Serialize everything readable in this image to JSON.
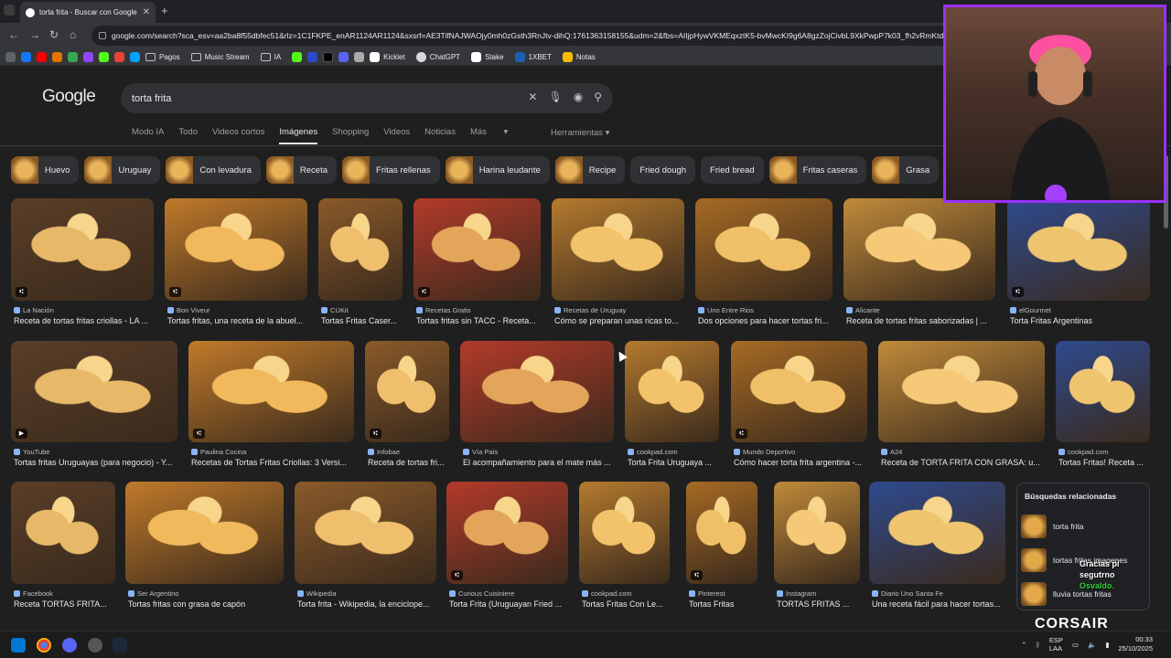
{
  "tab": {
    "title": "torta frita - Buscar con Google"
  },
  "address": {
    "url": "google.com/search?sca_esv=aa2ba8f55dbfec51&rlz=1C1FKPE_enAR1124AR1124&sxsrf=AE3TifNAJWAOjy0mh0zGsth3RnJtv-dihQ:1761363158155&udm=2&fbs=AIIjpHywVKMEqxztK5-bvMwcKI9g6A8gzZojCivbL9XkPwpP7k03_fh2vRmKtd"
  },
  "bookmarks": [
    {
      "label": "Pagos",
      "type": "folder"
    },
    {
      "label": "Music Stream",
      "type": "folder"
    },
    {
      "label": "IA",
      "type": "folder"
    },
    {
      "label": "Kicklet",
      "type": "site"
    },
    {
      "label": "ChatGPT",
      "type": "site"
    },
    {
      "label": "Stake",
      "type": "site"
    },
    {
      "label": "1XBET",
      "type": "site"
    },
    {
      "label": "Notas",
      "type": "site"
    }
  ],
  "google": {
    "logo": "Google",
    "query": "torta frita"
  },
  "navtabs": [
    "Modo IA",
    "Todo",
    "Videos cortos",
    "Imágenes",
    "Shopping",
    "Videos",
    "Noticias",
    "Más"
  ],
  "tools_label": "Herramientas",
  "chips": [
    "Huevo",
    "Uruguay",
    "Con levadura",
    "Receta",
    "Fritas rellenas",
    "Harina leudante",
    "Recipe",
    "Fried dough",
    "Fried bread",
    "Fritas caseras",
    "Grasa"
  ],
  "row1": [
    {
      "source": "La Nación",
      "title": "Receta de tortas fritas criollas - LA ..."
    },
    {
      "source": "Bon Viveur",
      "title": "Tortas fritas, una receta de la abuel..."
    },
    {
      "source": "CUKit",
      "title": "Tortas Fritas Caser..."
    },
    {
      "source": "Recetas Gratis",
      "title": "Tortas fritas sin TACC - Receta..."
    },
    {
      "source": "Recetas de Uruguay",
      "title": "Cómo se preparan unas ricas to..."
    },
    {
      "source": "Uno Entre Rios",
      "title": "Dos opciones para hacer tortas fri..."
    },
    {
      "source": "Alicante",
      "title": "Receta de tortas fritas saborizadas | ..."
    },
    {
      "source": "elGourmet",
      "title": "Torta Fritas Argentinas"
    }
  ],
  "row2": [
    {
      "source": "YouTube",
      "title": "Tortas fritas Uruguayas (para negocio) - Y..."
    },
    {
      "source": "Paulina Cocina",
      "title": "Recetas de Tortas Fritas Criollas: 3 Versi..."
    },
    {
      "source": "Infobae",
      "title": "Receta de tortas fri..."
    },
    {
      "source": "Vía País",
      "title": "El acompañamiento para el mate más ..."
    },
    {
      "source": "cookpad.com",
      "title": "Torta Frita Uruguaya ..."
    },
    {
      "source": "Mundo Deportivo",
      "title": "Cómo hacer torta frita argentina -..."
    },
    {
      "source": "A24",
      "title": "Receta de TORTA FRITA CON GRASA: u..."
    },
    {
      "source": "cookpad.com",
      "title": "Tortas Fritas! Receta ..."
    }
  ],
  "row3": [
    {
      "source": "Facebook",
      "title": "Receta TORTAS FRITA..."
    },
    {
      "source": "Ser Argentino",
      "title": "Tortas fritas con grasa de capón"
    },
    {
      "source": "Wikipedia",
      "title": "Torta frita - Wikipedia, la enciclope..."
    },
    {
      "source": "Curious Cuisiniere",
      "title": "Torta Frita (Uruguayan Fried ..."
    },
    {
      "source": "cookpad.com",
      "title": "Tortas Fritas Con Le..."
    },
    {
      "source": "Pinterest",
      "title": "Tortas Fritas"
    },
    {
      "source": "Instagram",
      "title": "TORTAS FRITAS ..."
    },
    {
      "source": "Diario Uno Santa Fe",
      "title": "Una receta fácil para hacer tortas..."
    }
  ],
  "related": {
    "heading": "Búsquedas relacionadas",
    "items": [
      "torta frita",
      "tortas fritas imagenes",
      "lluvia tortas fritas"
    ]
  },
  "overlay": {
    "line1": "Gracias pi",
    "line2": "segutrno",
    "line3": "Osvaldo.",
    "brand": "CORSAIR"
  },
  "tray": {
    "lang": "ESP",
    "region": "LAA",
    "time": "00:33",
    "date": "25/10/2025"
  },
  "colors": {
    "bg": "#1f1f1f",
    "accent": "#8ab4f8",
    "webcam_border": "#9b30ff"
  }
}
